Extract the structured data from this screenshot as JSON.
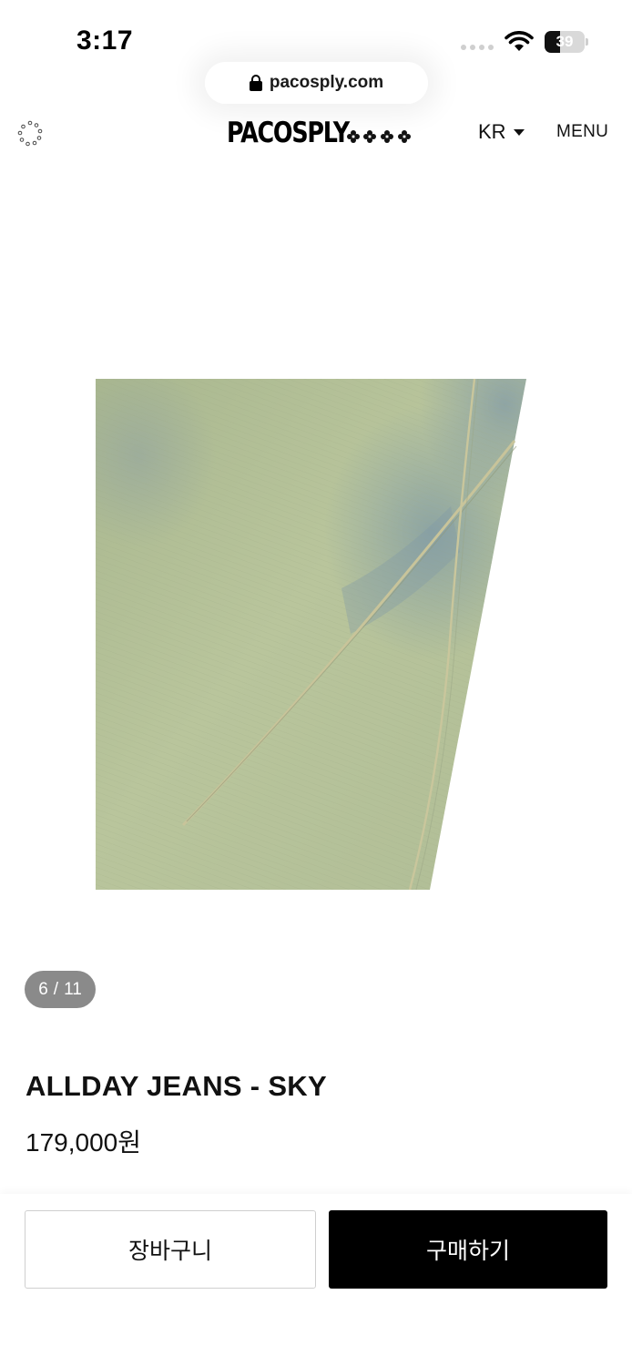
{
  "status_bar": {
    "time": "3:17",
    "battery_level": "39",
    "battery_percent": 39
  },
  "browser": {
    "url": "pacosply.com"
  },
  "header": {
    "logo_text": "PACOSPLY",
    "language": "KR",
    "menu_label": "MENU"
  },
  "gallery": {
    "current": "6",
    "separator": "/",
    "total": "11"
  },
  "product": {
    "name": "ALLDAY JEANS - SKY",
    "price": "179,000원"
  },
  "actions": {
    "cart_label": "장바구니",
    "buy_label": "구매하기"
  },
  "icons": {
    "lock": "lock-icon",
    "loading": "loading-spinner-icon",
    "caret": "caret-down-icon",
    "wifi": "wifi-icon",
    "battery": "battery-icon"
  },
  "colors": {
    "accent": "#000000",
    "counter_bg": "#8a8a8a",
    "denim": "#b7c39a"
  }
}
